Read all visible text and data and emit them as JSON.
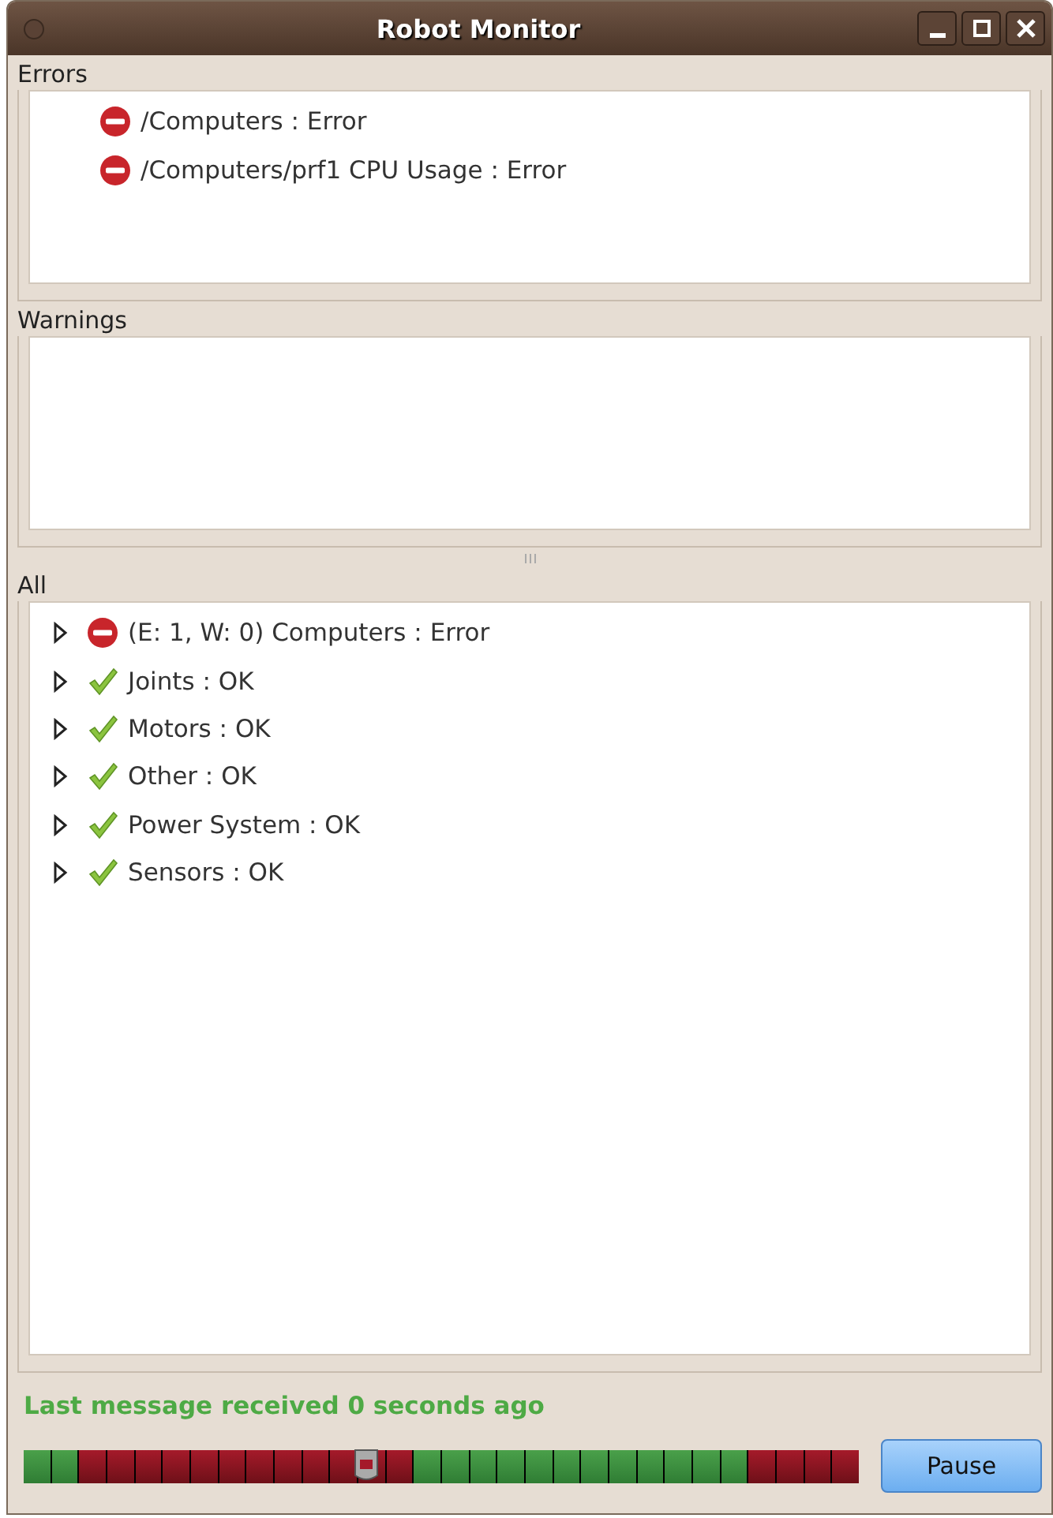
{
  "window": {
    "title": "Robot Monitor"
  },
  "errors": {
    "title": "Errors",
    "items": [
      {
        "label": "/Computers : Error",
        "kind": "error"
      },
      {
        "label": "/Computers/prf1 CPU Usage : Error",
        "kind": "error"
      }
    ]
  },
  "warnings": {
    "title": "Warnings"
  },
  "all": {
    "title": "All",
    "items": [
      {
        "label": "(E: 1, W: 0) Computers : Error",
        "kind": "error",
        "expanded": false
      },
      {
        "label": "Joints : OK",
        "kind": "ok",
        "expanded": false
      },
      {
        "label": "Motors : OK",
        "kind": "ok",
        "expanded": false
      },
      {
        "label": "Other : OK",
        "kind": "ok",
        "expanded": false
      },
      {
        "label": "Power System : OK",
        "kind": "ok",
        "expanded": false
      },
      {
        "label": "Sensors : OK",
        "kind": "ok",
        "expanded": false
      }
    ]
  },
  "status": "Last message received 0 seconds ago",
  "timeline": {
    "level": 0.41,
    "segments": [
      {
        "kind": "ok"
      },
      {
        "kind": "ok"
      },
      {
        "kind": "error"
      },
      {
        "kind": "error"
      },
      {
        "kind": "error"
      },
      {
        "kind": "error"
      },
      {
        "kind": "error"
      },
      {
        "kind": "error"
      },
      {
        "kind": "error"
      },
      {
        "kind": "error"
      },
      {
        "kind": "error"
      },
      {
        "kind": "error"
      },
      {
        "kind": "error"
      },
      {
        "kind": "error"
      },
      {
        "kind": "ok"
      },
      {
        "kind": "ok"
      },
      {
        "kind": "ok"
      },
      {
        "kind": "ok"
      },
      {
        "kind": "ok"
      },
      {
        "kind": "ok"
      },
      {
        "kind": "ok"
      },
      {
        "kind": "ok"
      },
      {
        "kind": "ok"
      },
      {
        "kind": "ok"
      },
      {
        "kind": "ok"
      },
      {
        "kind": "ok"
      },
      {
        "kind": "error"
      },
      {
        "kind": "error"
      },
      {
        "kind": "error"
      },
      {
        "kind": "error"
      }
    ]
  },
  "buttons": [
    {
      "label": "Pause"
    }
  ]
}
